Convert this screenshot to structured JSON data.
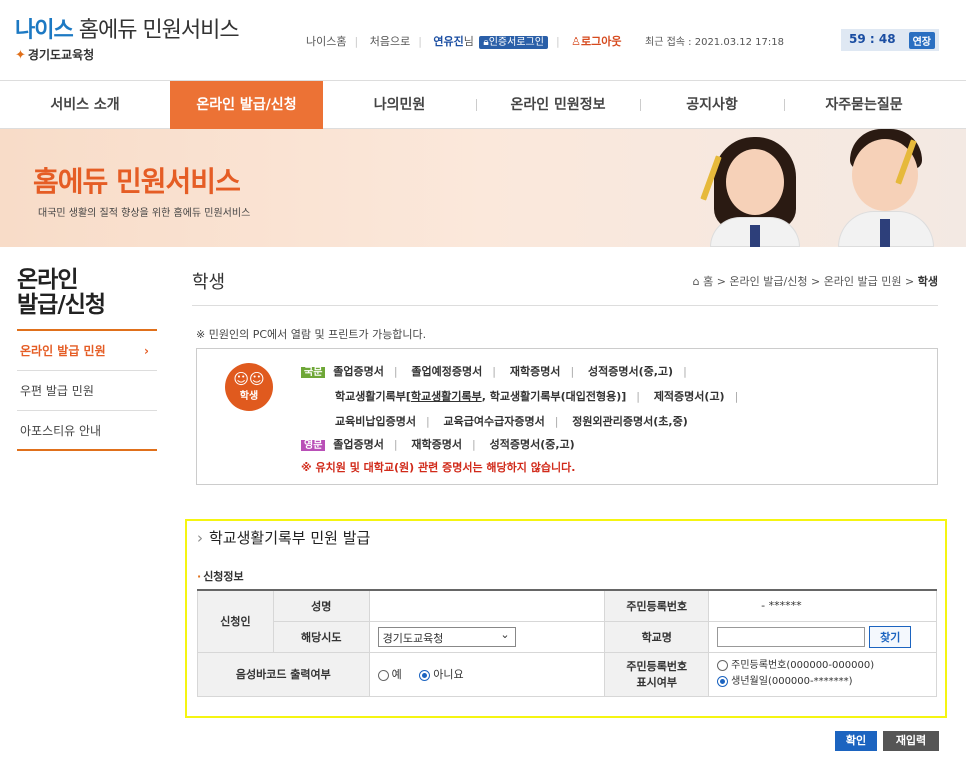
{
  "header": {
    "logo_nice": "나이스",
    "logo_rest": " 홈에듀 민원서비스",
    "logo_sub": "경기도교육청",
    "util_home": "나이스홈",
    "util_first": "처음으로",
    "user_name": "연유진",
    "user_suffix": "님",
    "cert_login": "인증서로그인",
    "logout": "로그아웃",
    "last_login": "최근 접속 : 2021.03.12 17:18",
    "timer": "59 : 48",
    "extend": "연장"
  },
  "gnb": [
    "서비스 소개",
    "온라인 발급/신청",
    "나의민원",
    "온라인 민원정보",
    "공지사항",
    "자주묻는질문"
  ],
  "banner": {
    "title": "홈에듀 민원서비스",
    "subtitle": "대국민 생활의 질적 향상을 위한 홈에듀 민원서비스"
  },
  "lnb": {
    "title1": "온라인",
    "title2": "발급/신청",
    "items": [
      "온라인 발급 민원",
      "우편 발급 민원",
      "아포스티유 안내"
    ]
  },
  "content": {
    "page_title": "학생",
    "breadcrumb": [
      "홈",
      "온라인 발급/신청",
      "온라인 발급 민원",
      "학생"
    ],
    "notice": "※ 민원인의 PC에서 열람 및 프린트가 가능합니다.",
    "student_label": "학생",
    "badge_ko": "국문",
    "badge_en": "영문",
    "ko_line1": [
      "졸업증명서",
      "졸업예정증명서",
      "재학증명서",
      "성적증명서(중,고)"
    ],
    "ko_line2_a": "학교생활기록부[",
    "ko_line2_u": "학교생활기록부",
    "ko_line2_b": ", 학교생활기록부(대입전형용)]",
    "ko_line2_c": "제적증명서(고)",
    "ko_line3": [
      "교육비납입증명서",
      "교육급여수급자증명서",
      "정원외관리증명서(초,중)"
    ],
    "en_line": [
      "졸업증명서",
      "재학증명서",
      "성적증명서(중,고)"
    ],
    "warning": "※ 유치원 및 대학교(원) 관련 증명서는 해당하지 않습니다."
  },
  "form": {
    "title": "학교생활기록부 민원 발급",
    "section": "신청정보",
    "applicant": "신청인",
    "name_label": "성명",
    "name_value": "",
    "rrn_label": "주민등록번호",
    "rrn_value": "- ******",
    "region_label": "해당시도",
    "region_value": "경기도교육청",
    "school_label": "학교명",
    "find_btn": "찾기",
    "barcode_label": "음성바코드 출력여부",
    "barcode_yes": "예",
    "barcode_no": "아니요",
    "rrn_display_label1": "주민등록번호",
    "rrn_display_label2": "표시여부",
    "rrn_opt1": "주민등록번호(000000-000000)",
    "rrn_opt2": "생년월일(000000-*******)",
    "confirm": "확인",
    "reset": "재입력"
  },
  "colors": {
    "brand_orange": "#ec7235",
    "brand_blue": "#1c64c0",
    "highlight_border": "#f5f511"
  }
}
